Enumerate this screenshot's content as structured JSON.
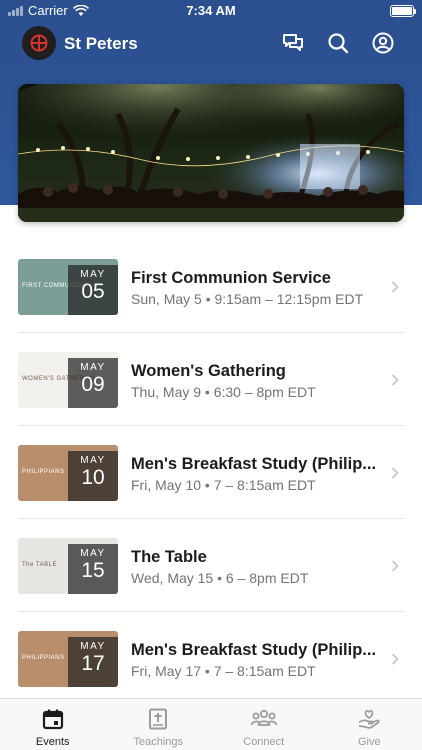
{
  "status_bar": {
    "carrier": "Carrier",
    "time": "7:34 AM"
  },
  "header": {
    "title": "St Peters"
  },
  "events": [
    {
      "title": "First Communion Service",
      "month": "MAY",
      "day": "05",
      "subtitle": "Sun, May 5 • 9:15am – 12:15pm EDT",
      "thumb_color": "#7b9f98",
      "thumb_text": "FIRST COMMUNION"
    },
    {
      "title": "Women's Gathering",
      "month": "MAY",
      "day": "09",
      "subtitle": "Thu, May 9 • 6:30 – 8pm EDT",
      "thumb_color": "#f3f1ee",
      "thumb_text": "WOMEN'S GATHERING"
    },
    {
      "title": "Men's Breakfast Study (Philip...",
      "month": "MAY",
      "day": "10",
      "subtitle": "Fri, May 10 • 7 – 8:15am EDT",
      "thumb_color": "#b98e6c",
      "thumb_text": "PHILIPPIANS"
    },
    {
      "title": "The Table",
      "month": "MAY",
      "day": "15",
      "subtitle": "Wed, May 15 • 6 – 8pm EDT",
      "thumb_color": "#e6e6e3",
      "thumb_text": "The TABLE"
    },
    {
      "title": "Men's Breakfast Study (Philip...",
      "month": "MAY",
      "day": "17",
      "subtitle": "Fri, May 17 • 7 – 8:15am EDT",
      "thumb_color": "#b98e6c",
      "thumb_text": "PHILIPPIANS"
    }
  ],
  "tabs": [
    {
      "label": "Events",
      "icon": "calendar-icon",
      "active": true
    },
    {
      "label": "Teachings",
      "icon": "bible-icon",
      "active": false
    },
    {
      "label": "Connect",
      "icon": "people-icon",
      "active": false
    },
    {
      "label": "Give",
      "icon": "give-hand-icon",
      "active": false
    }
  ],
  "colors": {
    "header": "#2b4f8f",
    "text": "#1c1c1e",
    "subtext": "#737378"
  }
}
